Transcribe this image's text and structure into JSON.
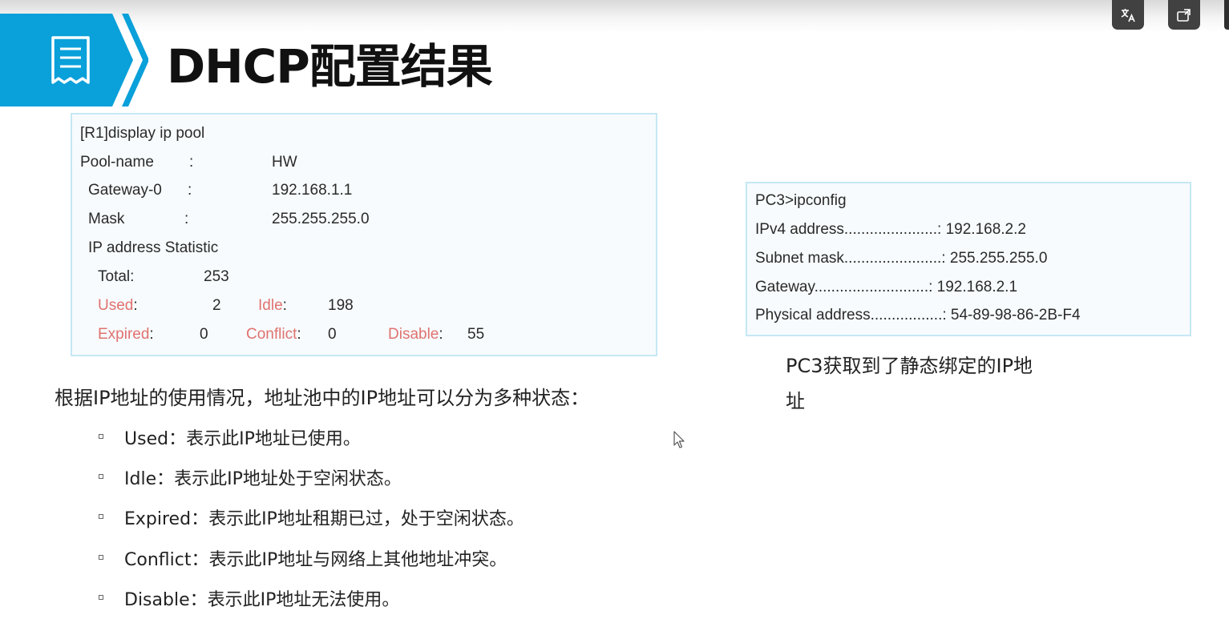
{
  "slide": {
    "title": "DHCP配置结果"
  },
  "pool_output": {
    "command": "[R1]display ip pool",
    "pool_name_label": "Pool-name",
    "pool_name_value": "HW",
    "gateway_label": "Gateway-0",
    "gateway_value": "192.168.1.1",
    "mask_label": "Mask",
    "mask_value": "255.255.255.0",
    "colon": ":",
    "statistic_label": "IP address Statistic",
    "total_label": "Total:",
    "total_value": "253",
    "used_label": "Used",
    "used_value": "2",
    "idle_label": "Idle",
    "idle_value": "198",
    "expired_label": "Expired",
    "expired_value": "0",
    "conflict_label": "Conflict",
    "conflict_value": "0",
    "disable_label": "Disable",
    "disable_value": "55"
  },
  "pc_output": {
    "command": "PC3>ipconfig",
    "ipv4_label": "IPv4 address......................: ",
    "ipv4_value": "192.168.2.2",
    "subnet_label": "Subnet mask.......................: ",
    "subnet_value": "255.255.255.0",
    "gateway_label": "Gateway...........................: ",
    "gateway_value": "192.168.2.1",
    "physical_label": "Physical address.................: ",
    "physical_value": "54-89-98-86-2B-F4"
  },
  "pc_caption": {
    "line1": "PC3获取到了静态绑定的IP地",
    "line2": "址"
  },
  "intro_text": "根据IP地址的使用情况，地址池中的IP地址可以分为多种状态：",
  "states": [
    {
      "term": "Used",
      "desc": "：表示此IP地址已使用。"
    },
    {
      "term": "Idle",
      "desc": "：表示此IP地址处于空闲状态。"
    },
    {
      "term": "Expired",
      "desc": "：表示此IP地址租期已过，处于空闲状态。"
    },
    {
      "term": "Conflict",
      "desc": "：表示此IP地址与网络上其他地址冲突。"
    },
    {
      "term": "Disable",
      "desc": "：表示此IP地址无法使用。"
    }
  ],
  "colors": {
    "banner_blue": "#0aa0da",
    "highlight_red": "#e0726f",
    "box_border": "#c6e8f4"
  },
  "icons": {
    "banner": "document-icon",
    "player_1": "translate-icon",
    "player_2": "popout-icon",
    "pointer": "mouse-cursor-icon"
  }
}
